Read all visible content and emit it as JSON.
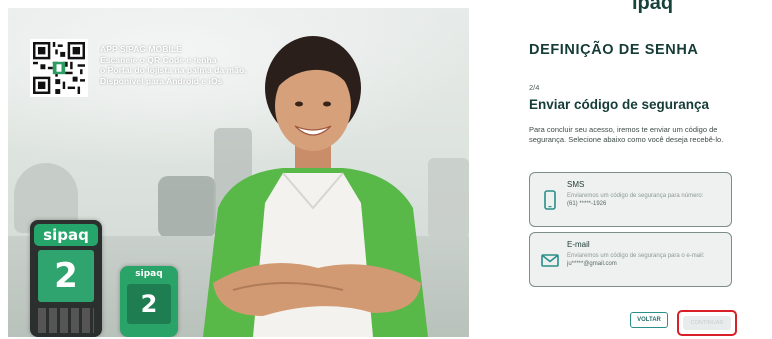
{
  "promo": {
    "app_title": "APP SIPAG MOBILE",
    "line1": "Escaneie o QR Code e tenha",
    "line2": "o Portal do lojista na palma da mão.",
    "line3": "Disponível para Android e iOs",
    "terminal_brand": "sipaq",
    "terminal_digit": "2",
    "small_terminal_brand": "sipaq"
  },
  "header": {
    "logo_fragment": "ipaq"
  },
  "form": {
    "title": "DEFINIÇÃO DE SENHA",
    "step": "2/4",
    "subtitle": "Enviar código de segurança",
    "description": "Para concluir seu acesso, iremos te enviar um código de segurança. Selecione abaixo como você deseja recebê-lo.",
    "options": [
      {
        "label": "SMS",
        "text": "Enviaremos um código de segurança para número:",
        "value": "(61) *****-1926",
        "icon": "phone-icon"
      },
      {
        "label": "E-mail",
        "text": "Enviaremos um código de segurança para o e-mail:",
        "value": "ju*****@gmail.com",
        "icon": "mail-icon"
      }
    ],
    "back_label": "VOLTAR",
    "continue_label": "CONTINUAR"
  },
  "colors": {
    "brand_dark": "#163c37",
    "accent_teal": "#2a8f88",
    "highlight_red": "#d91f27",
    "terminal_green": "#2fa46e"
  }
}
